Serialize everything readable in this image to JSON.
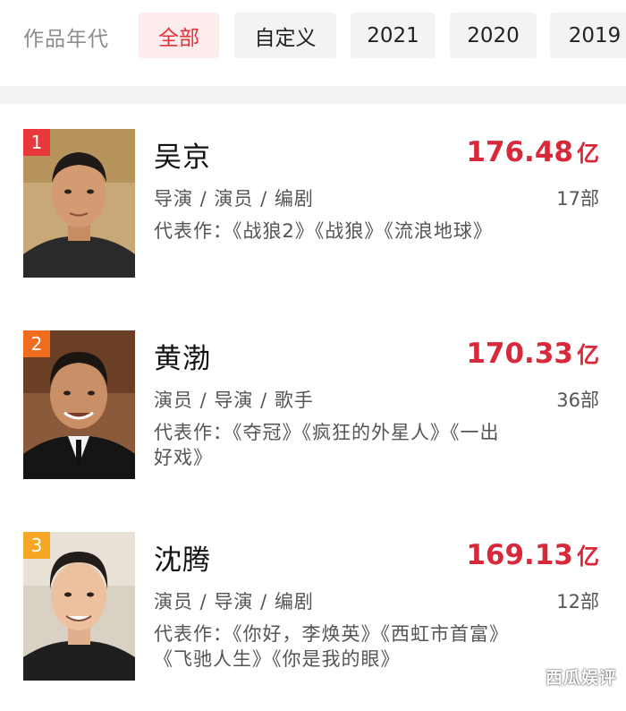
{
  "filter": {
    "label": "作品年代",
    "chips": [
      {
        "label": "全部",
        "active": true
      },
      {
        "label": "自定义",
        "active": false
      },
      {
        "label": "2021",
        "active": false
      },
      {
        "label": "2020",
        "active": false
      },
      {
        "label": "2019",
        "active": false
      }
    ]
  },
  "rankings": [
    {
      "rank": "1",
      "badge_color": "#e8383d",
      "name": "吴京",
      "box_office": "176.48",
      "unit": "亿",
      "roles": "导演 / 演员 / 编剧",
      "film_count": "17部",
      "works": "代表作：《战狼2》《战狼》《流浪地球》"
    },
    {
      "rank": "2",
      "badge_color": "#f06c1f",
      "name": "黄渤",
      "box_office": "170.33",
      "unit": "亿",
      "roles": "演员 / 导演 / 歌手",
      "film_count": "36部",
      "works": "代表作：《夺冠》《疯狂的外星人》《一出好戏》"
    },
    {
      "rank": "3",
      "badge_color": "#f5a623",
      "name": "沈腾",
      "box_office": "169.13",
      "unit": "亿",
      "roles": "演员 / 导演 / 编剧",
      "film_count": "12部",
      "works": "代表作：《你好，李焕英》《西虹市首富》《飞驰人生》《你是我的眼》"
    }
  ],
  "watermark": "西瓜娱评",
  "colors": {
    "accent": "#d8283a",
    "active_chip_bg": "#fdecec"
  }
}
